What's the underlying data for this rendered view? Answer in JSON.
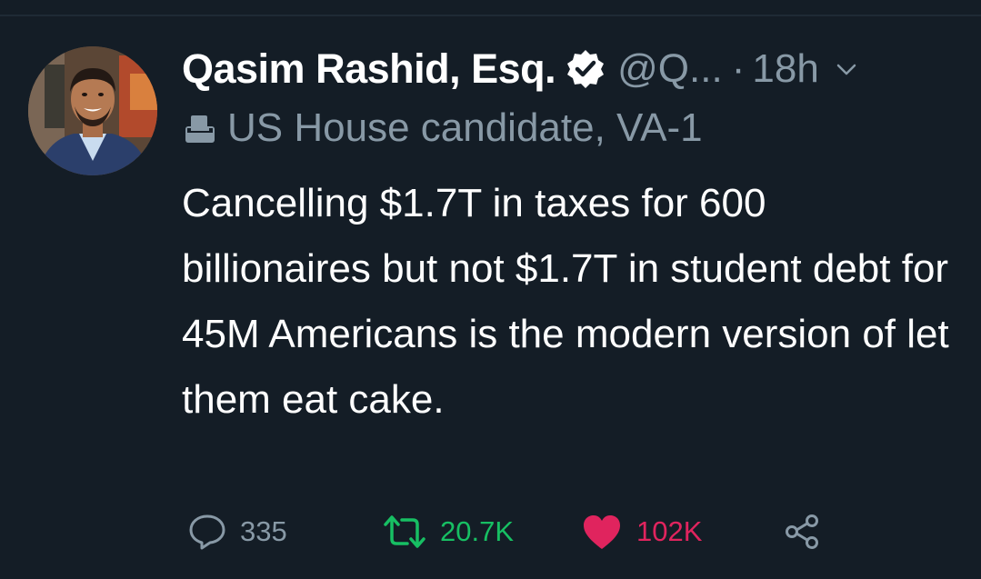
{
  "tweet": {
    "author_name": "Qasim Rashid, Esq.",
    "handle": "@Q...",
    "separator": "·",
    "time": "18h",
    "bio": "US House candidate, VA-1",
    "text": "Cancelling $1.7T in taxes for 600 billionaires but not $1.7T in student debt for 45M Americans is the modern version of let them eat cake.",
    "stats": {
      "replies": "335",
      "retweets": "20.7K",
      "likes": "102K"
    }
  },
  "icons": {
    "verified": "verified-badge-icon",
    "chevron": "chevron-down-icon",
    "bio": "ballot-box-icon",
    "reply": "reply-icon",
    "retweet": "retweet-icon",
    "like": "heart-icon",
    "share": "share-icon"
  },
  "colors": {
    "background": "#141d26",
    "text": "#ffffff",
    "muted": "#8899a6",
    "retweet_active": "#17bf63",
    "like_active": "#e0245e"
  }
}
